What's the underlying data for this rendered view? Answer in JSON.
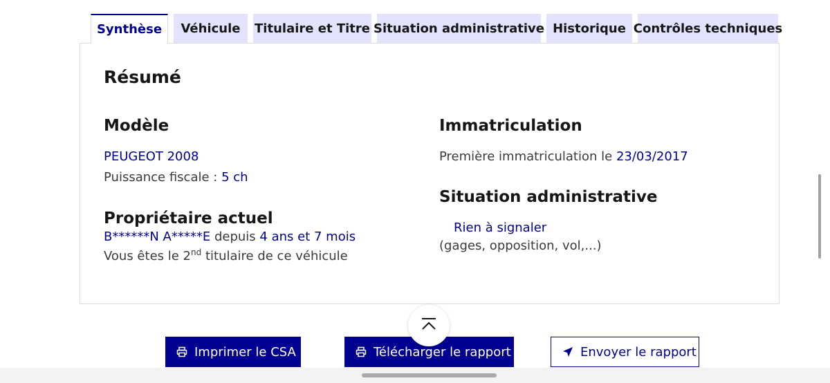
{
  "tabs": [
    {
      "label": "Synthèse"
    },
    {
      "label": "Véhicule"
    },
    {
      "label": "Titulaire et Titre"
    },
    {
      "label": "Situation administrative"
    },
    {
      "label": "Historique"
    },
    {
      "label": "Contrôles techniques"
    }
  ],
  "summary": {
    "title": "Résumé",
    "model": {
      "heading": "Modèle",
      "name": "PEUGEOT 2008",
      "power_label": "Puissance fiscale :",
      "power_value": "5 ch"
    },
    "owner": {
      "heading": "Propriétaire actuel",
      "name": "B******N A*****E",
      "since_label": "depuis",
      "since_value": "4 ans et 7 mois",
      "rank_prefix": "Vous êtes le 2",
      "rank_suffix": "nd",
      "rank_rest": "titulaire de ce véhicule"
    },
    "registration": {
      "heading": "Immatriculation",
      "first_label": "Première immatriculation le",
      "first_date": "23/03/2017"
    },
    "admin": {
      "heading": "Situation administrative",
      "status": "Rien à signaler",
      "details": "(gages, opposition, vol,...)"
    }
  },
  "actions": {
    "print_csa": "Imprimer le CSA",
    "download_report": "Télécharger le rapport",
    "send_report": "Envoyer le rapport"
  },
  "icons": {
    "print": "printer-icon",
    "send": "send-arrow-icon",
    "scroll_top": "chevron-up-bar-icon"
  },
  "colors": {
    "accent": "#000091",
    "tab_inactive_bg": "#e3e3fd",
    "text": "#3a3a3a"
  }
}
